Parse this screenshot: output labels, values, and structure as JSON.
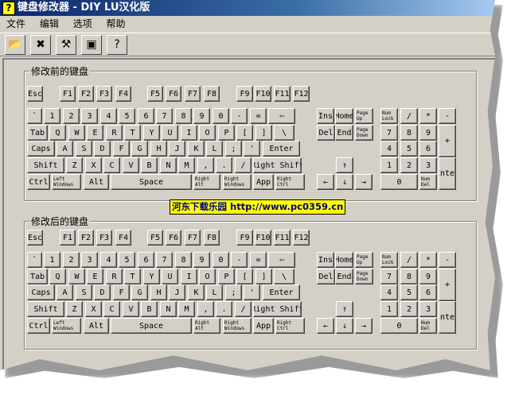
{
  "title": "键盘修改器 - DIY   LU汉化版",
  "menu": [
    "文件",
    "编辑",
    "选项",
    "帮助"
  ],
  "toolbar": [
    {
      "icon": "open-icon",
      "glyph": "📂"
    },
    {
      "icon": "delete-icon",
      "glyph": "✖"
    },
    {
      "icon": "tools-icon",
      "glyph": "⚒"
    },
    {
      "icon": "preview-icon",
      "glyph": "▣"
    },
    {
      "icon": "help-icon",
      "glyph": "?"
    }
  ],
  "keyboards": [
    {
      "label": "修改前的键盘"
    },
    {
      "label": "修改后的键盘"
    }
  ],
  "watermark": "河东下载乐园 http://www.pc0359.cn",
  "keys": {
    "frow": [
      "Esc",
      "F1",
      "F2",
      "F3",
      "F4",
      "F5",
      "F6",
      "F7",
      "F8",
      "F9",
      "F10",
      "F11",
      "F12"
    ],
    "rows": [
      [
        "`",
        "1",
        "2",
        "3",
        "4",
        "5",
        "6",
        "7",
        "8",
        "9",
        "0",
        "-",
        "=",
        "⇦"
      ],
      [
        "Tab",
        "Q",
        "W",
        "E",
        "R",
        "T",
        "Y",
        "U",
        "I",
        "O",
        "P",
        "[",
        "]",
        "\\"
      ],
      [
        "Caps",
        "A",
        "S",
        "D",
        "F",
        "G",
        "H",
        "J",
        "K",
        "L",
        ";",
        "'",
        "Enter"
      ],
      [
        "Shift",
        "Z",
        "X",
        "C",
        "V",
        "B",
        "N",
        "M",
        ",",
        ".",
        "/",
        "Right Shift"
      ],
      [
        "Ctrl",
        "Left\nWindows",
        "Alt",
        "Space",
        "Right\nAlt",
        "Right\nWindows",
        "App",
        "Right\nCtrl"
      ]
    ],
    "nav": [
      "Ins",
      "Home",
      "Page\nUp",
      "Del",
      "End",
      "Page\nDown"
    ],
    "arrows": [
      "↑",
      "←",
      "↓",
      "→"
    ],
    "numpad": [
      "Num\nLock",
      "/",
      "*",
      "-",
      "7",
      "8",
      "9",
      "+",
      "4",
      "5",
      "6",
      "1",
      "2",
      "3",
      "Enter",
      "0",
      "Num\nDel"
    ]
  }
}
